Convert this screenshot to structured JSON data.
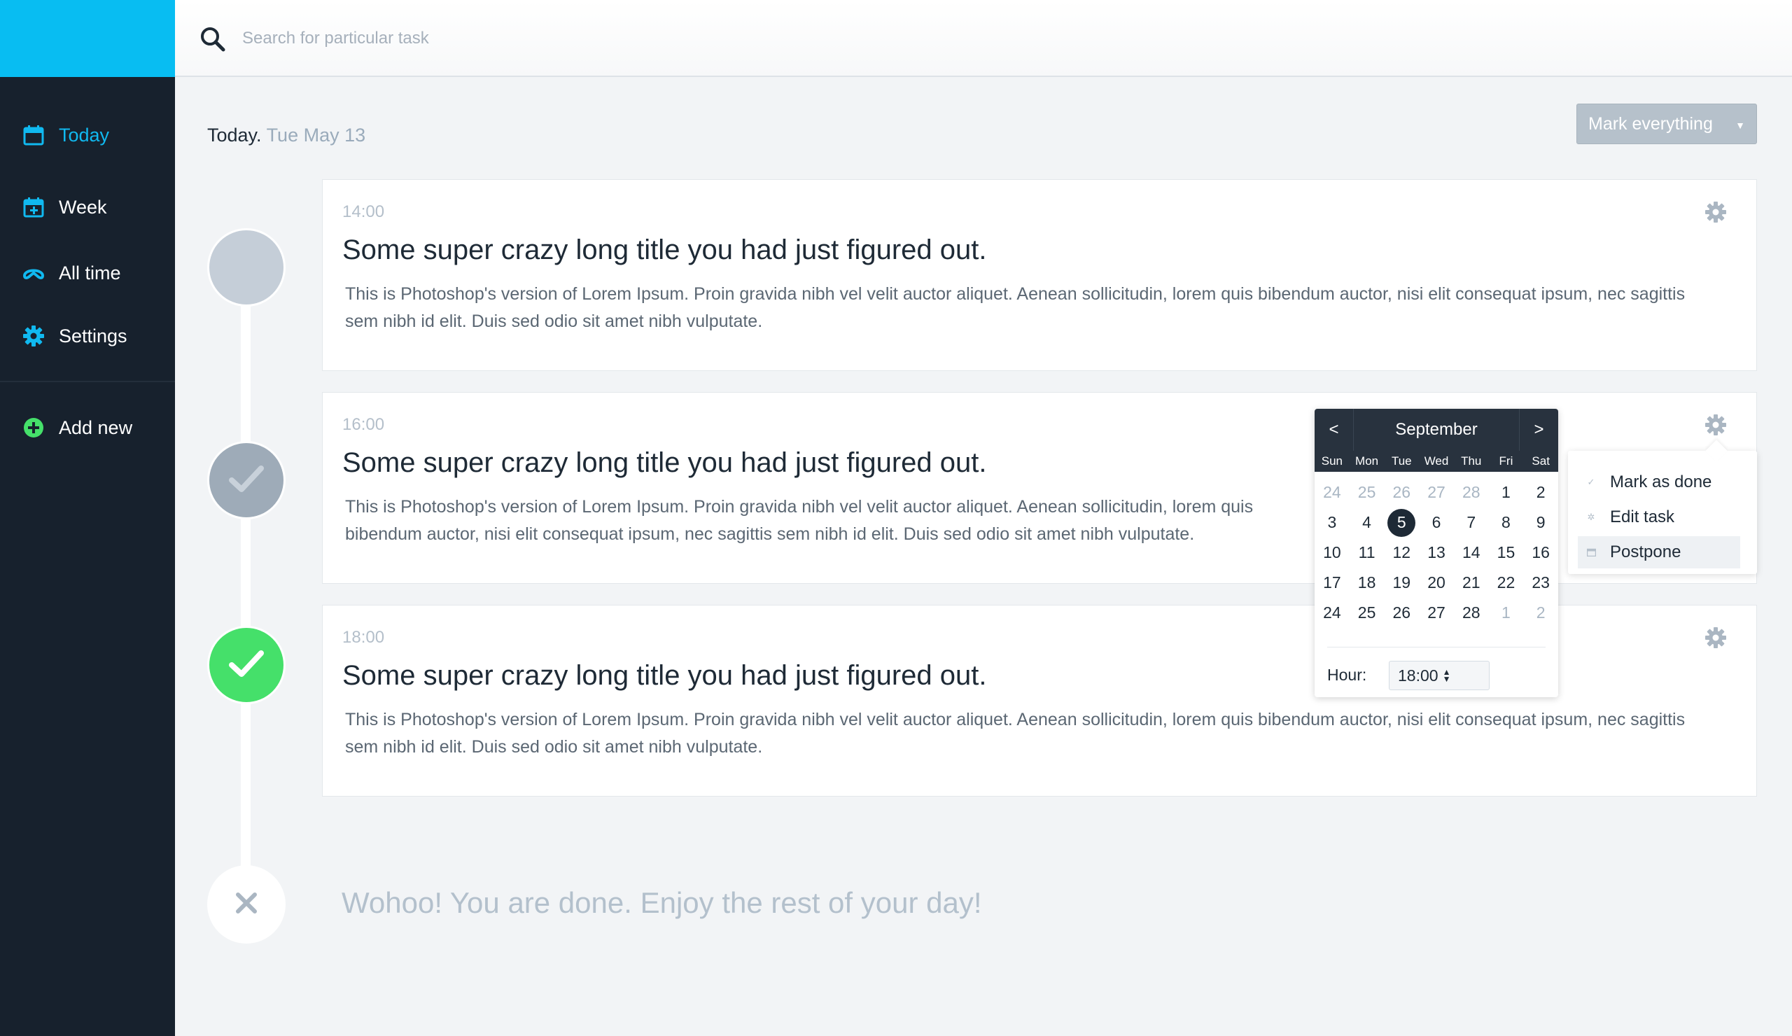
{
  "search": {
    "placeholder": "Search for particular task"
  },
  "sidebar": {
    "items": [
      {
        "label": "Today",
        "icon": "calendar-icon"
      },
      {
        "label": "Week",
        "icon": "calendar-plus-icon"
      },
      {
        "label": "All time",
        "icon": "infinity-icon"
      },
      {
        "label": "Settings",
        "icon": "gear-icon"
      }
    ],
    "add_new": {
      "label": "Add new",
      "icon": "plus-circle-icon"
    }
  },
  "header": {
    "prefix": "Today.",
    "date": "Tue May 13"
  },
  "actions": {
    "mark_everything": "Mark everything"
  },
  "tasks": [
    {
      "time": "14:00",
      "title": "Some super crazy long title you had just figured out.",
      "description": "This is Photoshop's version  of Lorem Ipsum. Proin gravida nibh vel velit auctor aliquet. Aenean sollicitudin, lorem quis bibendum auctor, nisi elit consequat ipsum, nec sagittis sem nibh id elit. Duis sed odio sit amet nibh vulputate.",
      "status": "pending"
    },
    {
      "time": "16:00",
      "title": "Some super crazy long title you had just figured out.",
      "description": "This is Photoshop's version  of Lorem Ipsum. Proin gravida nibh vel velit auctor aliquet. Aenean sollicitudin, lorem quis bibendum auctor, nisi elit consequat ipsum, nec sagittis sem nibh id elit. Duis sed odio sit amet nibh vulputate.",
      "status": "checked"
    },
    {
      "time": "18:00",
      "title": "Some super crazy long title you had just figured out.",
      "description": "This is Photoshop's version  of Lorem Ipsum. Proin gravida nibh vel velit auctor aliquet. Aenean sollicitudin, lorem quis bibendum auctor, nisi elit consequat ipsum, nec sagittis sem nibh id elit. Duis sed odio sit amet nibh vulputate.",
      "status": "done"
    }
  ],
  "done_message": "Wohoo! You are done. Enjoy the rest of your day!",
  "calendar": {
    "prev": "<",
    "next": ">",
    "month": "September",
    "weekdays": [
      "Sun",
      "Mon",
      "Tue",
      "Wed",
      "Thu",
      "Fri",
      "Sat"
    ],
    "weeks": [
      [
        {
          "d": "24",
          "m": true
        },
        {
          "d": "25",
          "m": true
        },
        {
          "d": "26",
          "m": true
        },
        {
          "d": "27",
          "m": true
        },
        {
          "d": "28",
          "m": true
        },
        {
          "d": "1"
        },
        {
          "d": "2"
        }
      ],
      [
        {
          "d": "3"
        },
        {
          "d": "4"
        },
        {
          "d": "5",
          "s": true
        },
        {
          "d": "6"
        },
        {
          "d": "7"
        },
        {
          "d": "8"
        },
        {
          "d": "9"
        }
      ],
      [
        {
          "d": "10"
        },
        {
          "d": "11"
        },
        {
          "d": "12"
        },
        {
          "d": "13"
        },
        {
          "d": "14"
        },
        {
          "d": "15"
        },
        {
          "d": "16"
        }
      ],
      [
        {
          "d": "17"
        },
        {
          "d": "18"
        },
        {
          "d": "19"
        },
        {
          "d": "20"
        },
        {
          "d": "21"
        },
        {
          "d": "22"
        },
        {
          "d": "23"
        }
      ],
      [
        {
          "d": "24"
        },
        {
          "d": "25"
        },
        {
          "d": "26"
        },
        {
          "d": "27"
        },
        {
          "d": "28"
        },
        {
          "d": "1",
          "m": true
        },
        {
          "d": "2",
          "m": true
        }
      ]
    ],
    "hour_label": "Hour:",
    "hour_value": "18:00"
  },
  "context_menu": {
    "items": [
      {
        "label": "Mark as done",
        "icon": "check-icon"
      },
      {
        "label": "Edit task",
        "icon": "small-gear-icon"
      },
      {
        "label": "Postpone",
        "icon": "small-calendar-icon"
      }
    ],
    "active_index": 2
  },
  "colors": {
    "accent": "#08bdf2",
    "sidebar": "#17212d",
    "success": "#45e06a",
    "muted": "#b3c0cc"
  }
}
